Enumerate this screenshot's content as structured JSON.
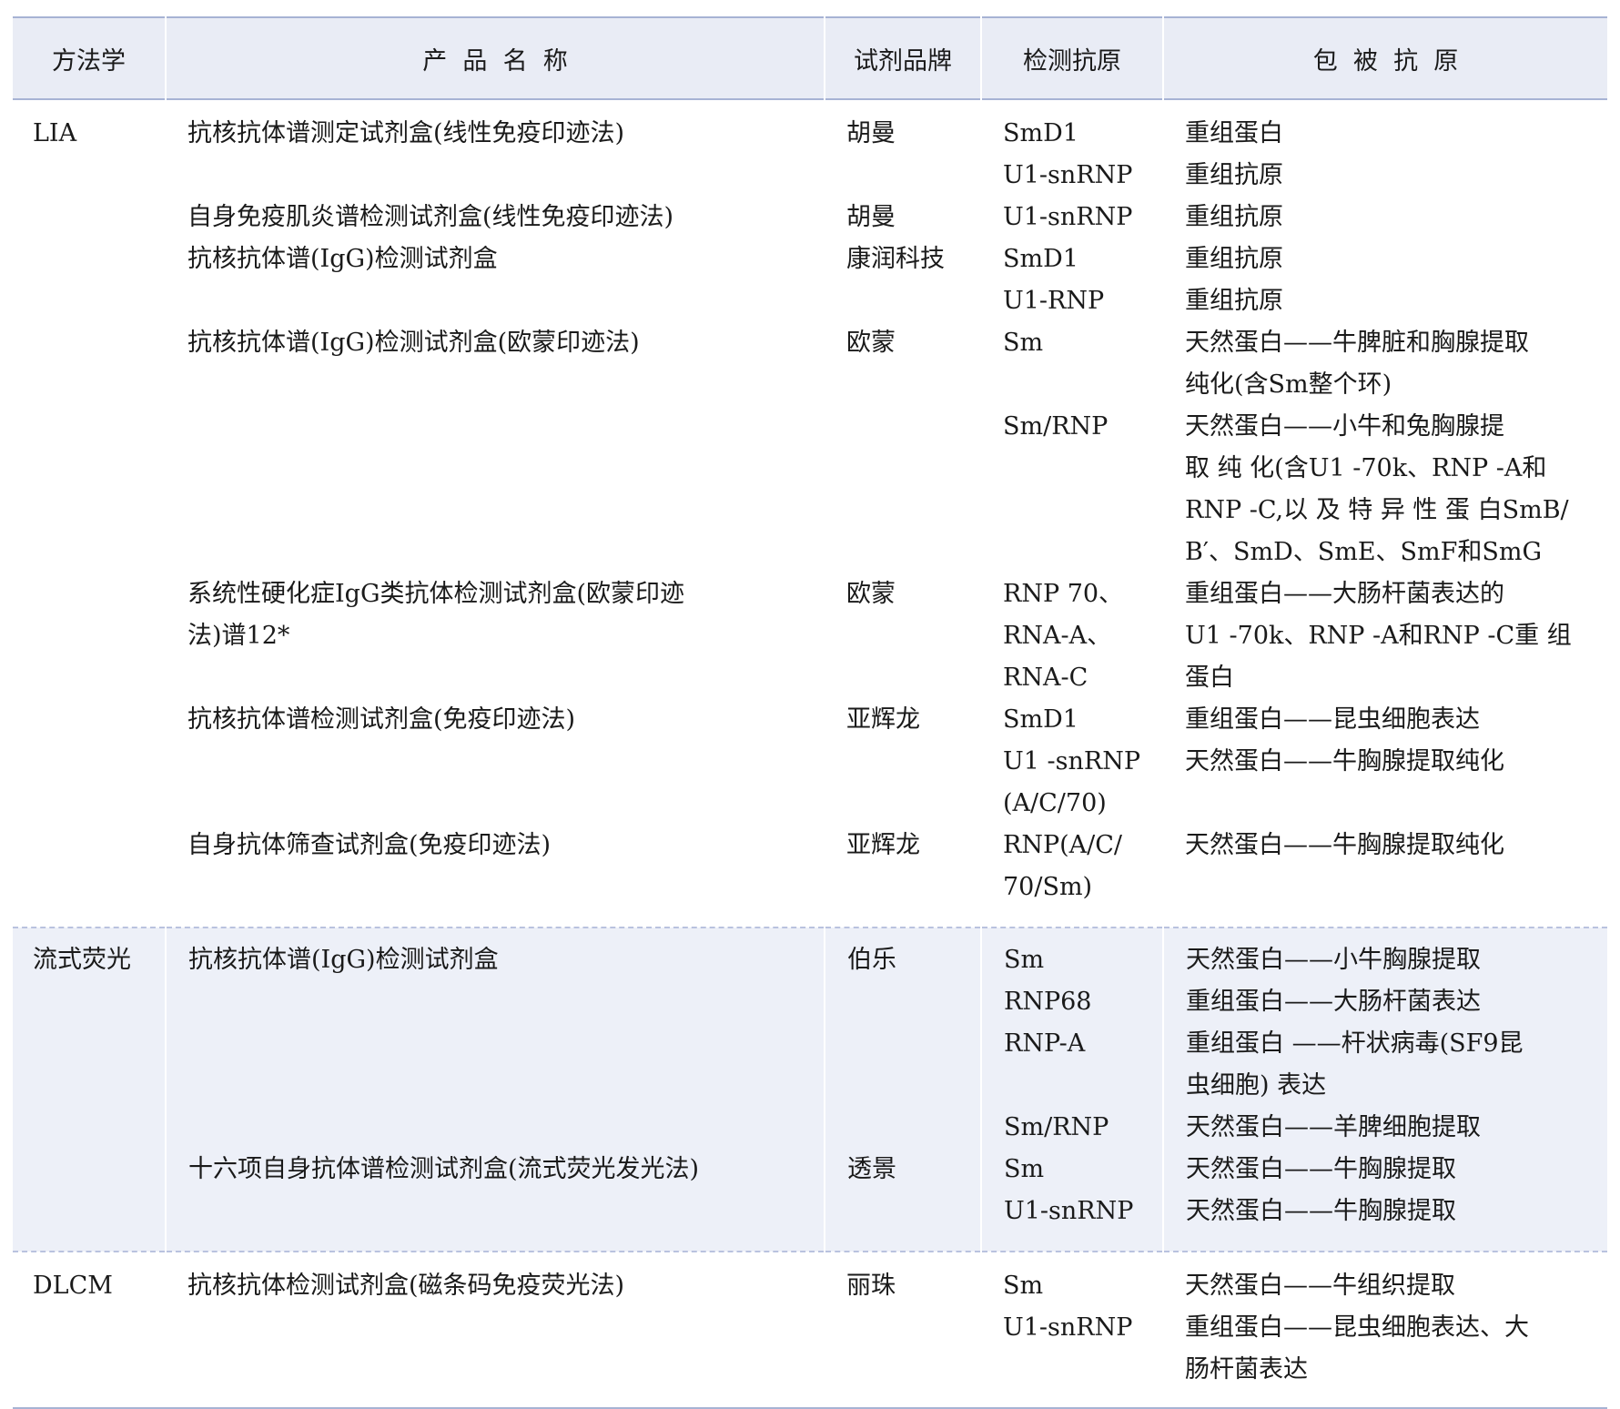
{
  "header": {
    "method": "方法学",
    "product": "产  品  名  称",
    "brand": "试剂品牌",
    "antigen": "检测抗原",
    "coating": "包  被  抗  原"
  },
  "groups": [
    {
      "method": "LIA",
      "products": [
        "抗核抗体谱测定试剂盒(线性免疫印迹法)",
        "",
        "自身免疫肌炎谱检测试剂盒(线性免疫印迹法)",
        "抗核抗体谱(IgG)检测试剂盒",
        "",
        "抗核抗体谱(IgG)检测试剂盒(欧蒙印迹法)",
        "",
        "",
        "",
        "",
        "",
        "系统性硬化症IgG类抗体检测试剂盒(欧蒙印迹",
        "法)谱12*",
        "",
        "抗核抗体谱检测试剂盒(免疫印迹法)",
        "",
        "",
        "自身抗体筛查试剂盒(免疫印迹法)"
      ],
      "brands": [
        "胡曼",
        "",
        "胡曼",
        "康润科技",
        "",
        "欧蒙",
        "",
        "",
        "",
        "",
        "",
        "欧蒙",
        "",
        "",
        "亚辉龙",
        "",
        "",
        "亚辉龙"
      ],
      "antigens": [
        "SmD1",
        "U1-snRNP",
        "U1-snRNP",
        "SmD1",
        "U1-RNP",
        "Sm",
        "",
        "Sm/RNP",
        "",
        "",
        "",
        "RNP 70、",
        "RNA-A、",
        "RNA-C",
        "SmD1",
        "U1 -snRNP",
        "(A/C/70)",
        "RNP(A/C/",
        "70/Sm)"
      ],
      "coatings": [
        "重组蛋白",
        "重组抗原",
        "重组抗原",
        "重组抗原",
        "重组抗原",
        "天然蛋白——牛脾脏和胸腺提取",
        "纯化(含Sm整个环)",
        "天然蛋白——小牛和兔胸腺提",
        "取 纯 化(含U1 -70k、RNP -A和",
        "RNP -C,以 及 特 异 性 蛋 白SmB/",
        "B′、SmD、SmE、SmF和SmG",
        "重组蛋白——大肠杆菌表达的",
        "U1 -70k、RNP -A和RNP -C重  组",
        "蛋白",
        "重组蛋白——昆虫细胞表达",
        "天然蛋白——牛胸腺提取纯化",
        "",
        "天然蛋白——牛胸腺提取纯化"
      ]
    },
    {
      "method": "流式荧光",
      "products": [
        "抗核抗体谱(IgG)检测试剂盒",
        "",
        "",
        "",
        "",
        "十六项自身抗体谱检测试剂盒(流式荧光发光法)"
      ],
      "brands": [
        "伯乐",
        "",
        "",
        "",
        "",
        "透景"
      ],
      "antigens": [
        "Sm",
        "RNP68",
        "RNP-A",
        "",
        "Sm/RNP",
        "Sm",
        "U1-snRNP"
      ],
      "coatings": [
        "天然蛋白——小牛胸腺提取",
        "重组蛋白——大肠杆菌表达",
        "重组蛋白 ——杆状病毒(SF9昆",
        "虫细胞) 表达",
        "天然蛋白——羊脾细胞提取",
        "天然蛋白——牛胸腺提取",
        "天然蛋白——牛胸腺提取"
      ]
    },
    {
      "method": "DLCM",
      "products": [
        "抗核抗体检测试剂盒(磁条码免疫荧光法)"
      ],
      "brands": [
        "丽珠"
      ],
      "antigens": [
        "Sm",
        "U1-snRNP"
      ],
      "coatings": [
        "天然蛋白——牛组织提取",
        "重组蛋白——昆虫细胞表达、大",
        "肠杆菌表达"
      ]
    }
  ]
}
